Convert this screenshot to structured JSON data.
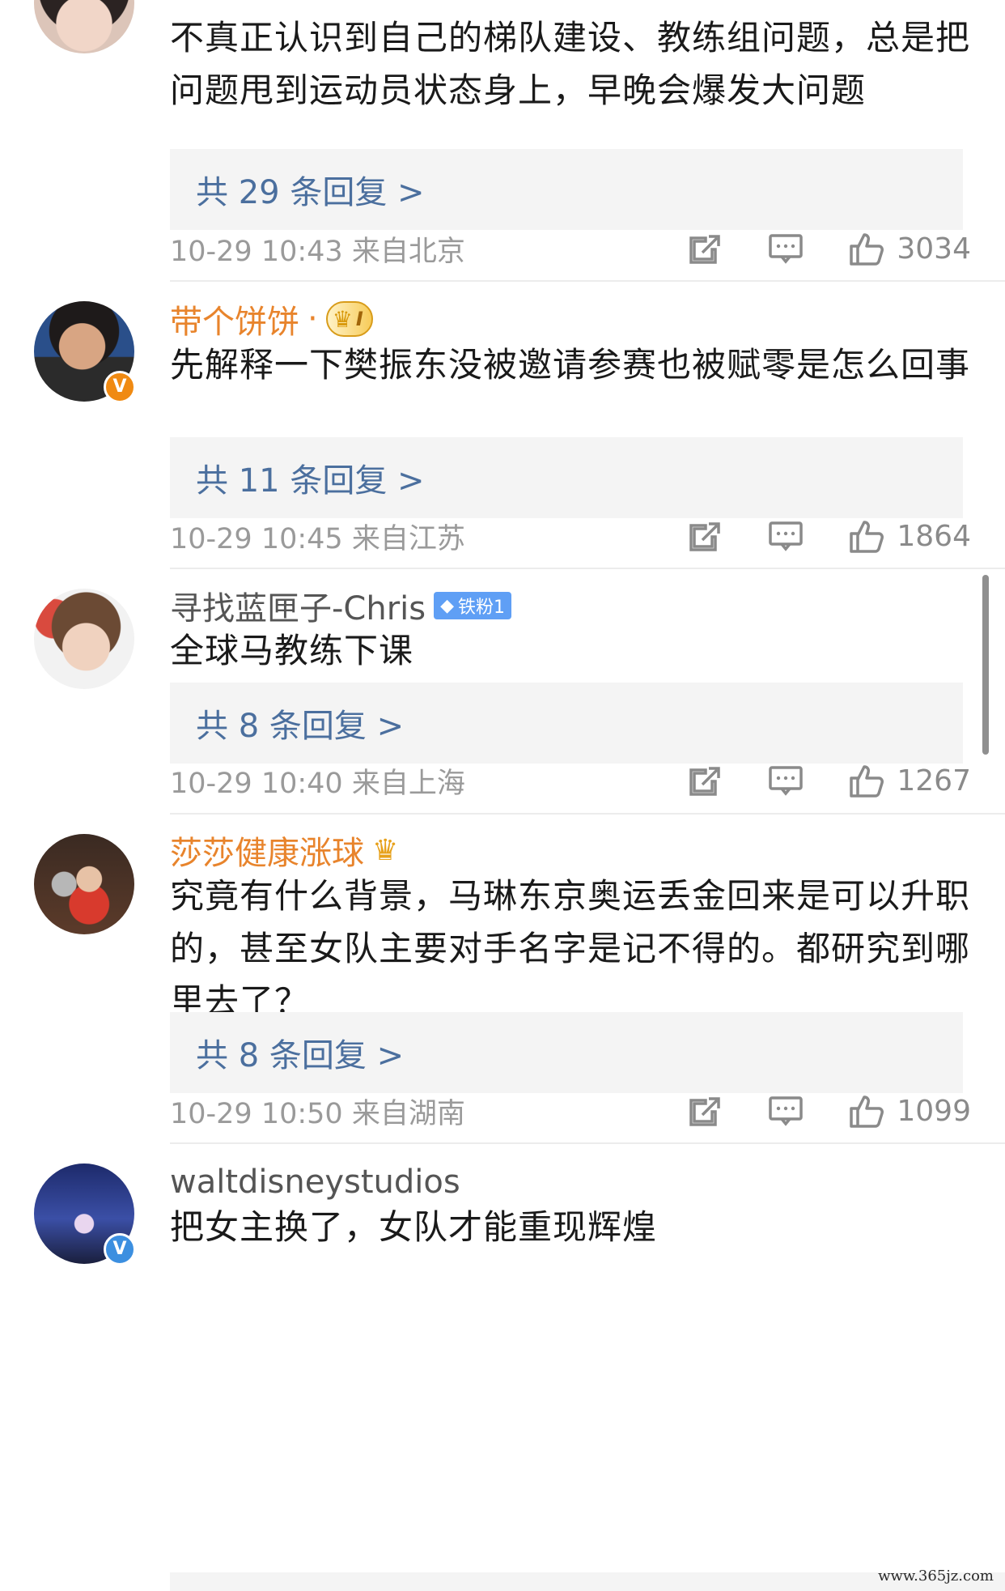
{
  "comments": [
    {
      "username": "",
      "text": "不真正认识到自己的梯队建设、教练组问题，总是把问题甩到运动员状态身上，早晚会爆发大问题",
      "replies": "共 29 条回复 >",
      "time": "10-29 10:43 来自北京",
      "likes": "3034"
    },
    {
      "username": "带个饼饼",
      "badge": "I",
      "text": "先解释一下樊振东没被邀请参赛也被赋零是怎么回事",
      "replies": "共 11 条回复 >",
      "time": "10-29 10:45 来自江苏",
      "likes": "1864",
      "verified": "V"
    },
    {
      "username": "寻找蓝匣子-Chris",
      "badge": "铁粉1",
      "text": "全球马教练下课",
      "replies": "共 8 条回复 >",
      "time": "10-29 10:40 来自上海",
      "likes": "1267"
    },
    {
      "username": "莎莎健康涨球",
      "text": "究竟有什么背景，马琳东京奥运丢金回来是可以升职的，甚至女队主要对手名字是记不得的。都研究到哪里去了？",
      "replies": "共 8 条回复 >",
      "time": "10-29 10:50 来自湖南",
      "likes": "1099"
    },
    {
      "username": "waltdisneystudios",
      "text": "把女主换了，女队才能重现辉煌",
      "verified": "V"
    }
  ],
  "watermark": "www.365jz.com",
  "colors": {
    "reply_link": "#4b6f9e",
    "vip_name": "#e8842c",
    "meta_gray": "#9a9a9a",
    "reply_bg": "#f4f4f4"
  },
  "icons": [
    "share-icon",
    "comment-icon",
    "thumbs-up-icon"
  ]
}
